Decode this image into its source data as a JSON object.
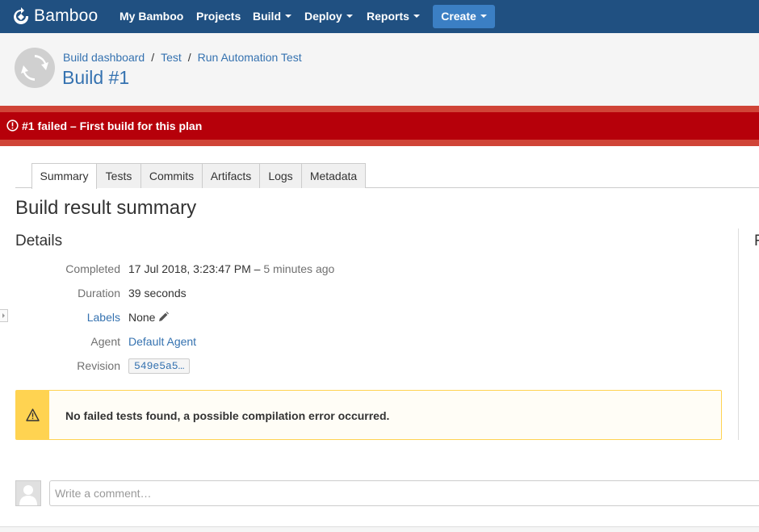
{
  "header": {
    "logo_text": "Bamboo",
    "nav": [
      {
        "label": "My Bamboo",
        "dropdown": false
      },
      {
        "label": "Projects",
        "dropdown": false
      },
      {
        "label": "Build",
        "dropdown": true
      },
      {
        "label": "Deploy",
        "dropdown": true
      },
      {
        "label": "Reports",
        "dropdown": true
      }
    ],
    "create_label": "Create",
    "colors": {
      "bar": "#205081",
      "create_button": "#3b7fc4"
    }
  },
  "breadcrumbs": [
    "Build dashboard",
    "Test",
    "Run Automation Test"
  ],
  "page_title": "Build #1",
  "banner": {
    "text": "#1 failed – First build for this plan",
    "icon": "error-circle-icon",
    "color": "#b6000a"
  },
  "tabs": [
    {
      "label": "Summary",
      "active": true
    },
    {
      "label": "Tests",
      "active": false
    },
    {
      "label": "Commits",
      "active": false
    },
    {
      "label": "Artifacts",
      "active": false
    },
    {
      "label": "Logs",
      "active": false
    },
    {
      "label": "Metadata",
      "active": false
    }
  ],
  "summary": {
    "title": "Build result summary",
    "details_title": "Details",
    "right_title_partial": "F",
    "details": {
      "completed_label": "Completed",
      "completed_value": "17 Jul 2018, 3:23:47 PM",
      "completed_sep": " – ",
      "completed_relative": "5 minutes ago",
      "duration_label": "Duration",
      "duration_value": "39 seconds",
      "labels_label": "Labels",
      "labels_value": "None",
      "agent_label": "Agent",
      "agent_value": "Default Agent",
      "revision_label": "Revision",
      "revision_value": "549e5a5…"
    }
  },
  "warning": {
    "text": "No failed tests found, a possible compilation error occurred.",
    "icon": "warning-triangle-icon",
    "color": "#ffd351"
  },
  "comment": {
    "placeholder": "Write a comment…"
  }
}
